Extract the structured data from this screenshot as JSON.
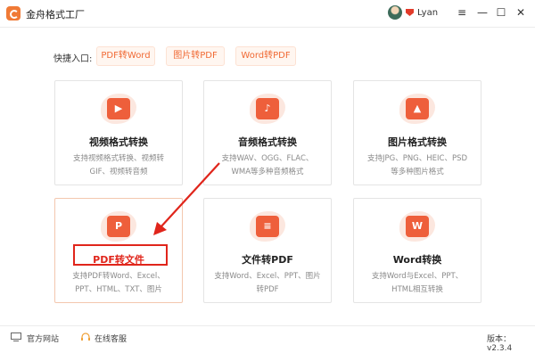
{
  "app": {
    "title": "金舟格式工厂"
  },
  "user": {
    "name": "Lyan"
  },
  "window_controls": {
    "menu": "≡",
    "minimize": "—",
    "maximize": "☐",
    "close": "✕"
  },
  "quick_entry": {
    "label": "快捷入口:",
    "buttons": [
      "PDF转Word",
      "图片转PDF",
      "Word转PDF"
    ]
  },
  "cards": [
    {
      "title": "视频格式转换",
      "desc": "支持视频格式转换、视频转GIF、视频转音频",
      "icon": "video-play-icon",
      "glyph": "▶"
    },
    {
      "title": "音频格式转换",
      "desc": "支持WAV、OGG、FLAC、WMA等多种音频格式",
      "icon": "music-note-icon",
      "glyph": "♪"
    },
    {
      "title": "图片格式转换",
      "desc": "支持JPG、PNG、HEIC、PSD等多种图片格式",
      "icon": "image-icon",
      "glyph": "▲"
    },
    {
      "title": "PDF转文件",
      "desc": "支持PDF转Word、Excel、PPT、HTML、TXT、图片",
      "icon": "pdf-p-icon",
      "glyph": "P"
    },
    {
      "title": "文件转PDF",
      "desc": "支持Word、Excel、PPT、图片转PDF",
      "icon": "document-lines-icon",
      "glyph": "≡"
    },
    {
      "title": "Word转换",
      "desc": "支持Word与Excel、PPT、HTML相互转换",
      "icon": "word-w-icon",
      "glyph": "W"
    }
  ],
  "footer": {
    "website": "官方网站",
    "service": "在线客服",
    "version": "版本：v2.3.4"
  },
  "colors": {
    "accent": "#f06a35",
    "highlight": "#e0251b"
  }
}
